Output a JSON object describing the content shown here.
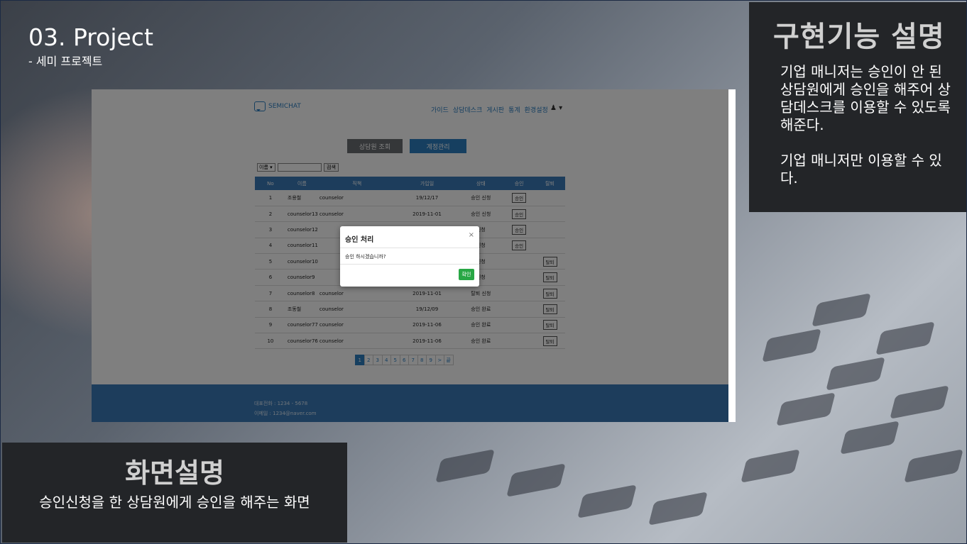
{
  "slide": {
    "title": "03. Project",
    "subtitle": "- 세미 프로젝트"
  },
  "feature_box": {
    "heading": "구현기능 설명",
    "paragraph1": "기업 매니저는 승인이 안 된 상담원에게 승인을 해주어 상담데스크를 이용할 수 있도록 해준다.",
    "paragraph2": "기업 매니저만 이용할 수 있다."
  },
  "screen_box": {
    "heading": "화면설명",
    "description": "승인신청을 한 상담원에게 승인을 해주는 화면"
  },
  "app": {
    "logo": "SEMICHAT",
    "nav": [
      "가이드",
      "상담데스크",
      "게시판",
      "통계",
      "환경설정"
    ],
    "user_caret": "▾",
    "tabs": {
      "search": "상담원 조회",
      "account": "계정관리"
    },
    "search": {
      "select_value": "이름 ▾",
      "button": "검색"
    },
    "table": {
      "headers": [
        "No",
        "이름",
        "직책",
        "가입일",
        "상태",
        "승인",
        "탈퇴"
      ],
      "rows": [
        {
          "no": "1",
          "name": "조용철",
          "role": "counselor",
          "date": "19/12/17",
          "status": "승인 신청",
          "approve": "승인",
          "leave": ""
        },
        {
          "no": "2",
          "name": "counselor13",
          "role": "counselor",
          "date": "2019-11-01",
          "status": "승인 신청",
          "approve": "승인",
          "leave": ""
        },
        {
          "no": "3",
          "name": "counselor12",
          "role": "",
          "date": "",
          "status": "신청",
          "approve": "승인",
          "leave": ""
        },
        {
          "no": "4",
          "name": "counselor11",
          "role": "",
          "date": "",
          "status": "신청",
          "approve": "승인",
          "leave": ""
        },
        {
          "no": "5",
          "name": "counselor10",
          "role": "",
          "date": "",
          "status": "신청",
          "approve": "",
          "leave": "탈퇴"
        },
        {
          "no": "6",
          "name": "counselor9",
          "role": "",
          "date": "",
          "status": "신청",
          "approve": "",
          "leave": "탈퇴"
        },
        {
          "no": "7",
          "name": "counselor8",
          "role": "counselor",
          "date": "2019-11-01",
          "status": "탈퇴 신청",
          "approve": "",
          "leave": "탈퇴"
        },
        {
          "no": "8",
          "name": "조동철",
          "role": "counselor",
          "date": "19/12/09",
          "status": "승인 완료",
          "approve": "",
          "leave": "탈퇴"
        },
        {
          "no": "9",
          "name": "counselor77",
          "role": "counselor",
          "date": "2019-11-06",
          "status": "승인 완료",
          "approve": "",
          "leave": "탈퇴"
        },
        {
          "no": "10",
          "name": "counselor76",
          "role": "counselor",
          "date": "2019-11-06",
          "status": "승인 완료",
          "approve": "",
          "leave": "탈퇴"
        }
      ]
    },
    "pagination": [
      "1",
      "2",
      "3",
      "4",
      "5",
      "6",
      "7",
      "8",
      "9",
      ">",
      "끝"
    ],
    "pagination_active": "1",
    "footer": {
      "phone": "대표전화 : 1234 - 5678",
      "email": "이메일 : 1234@naver.com"
    },
    "modal": {
      "title": "승인 처리",
      "close": "×",
      "message": "승인 하시겠습니까?",
      "confirm": "확인"
    }
  },
  "colors": {
    "accent_blue": "#2d7fc1",
    "header_blue": "#3a7ab8",
    "confirm_green": "#28a745",
    "panel_dark": "#232528"
  }
}
